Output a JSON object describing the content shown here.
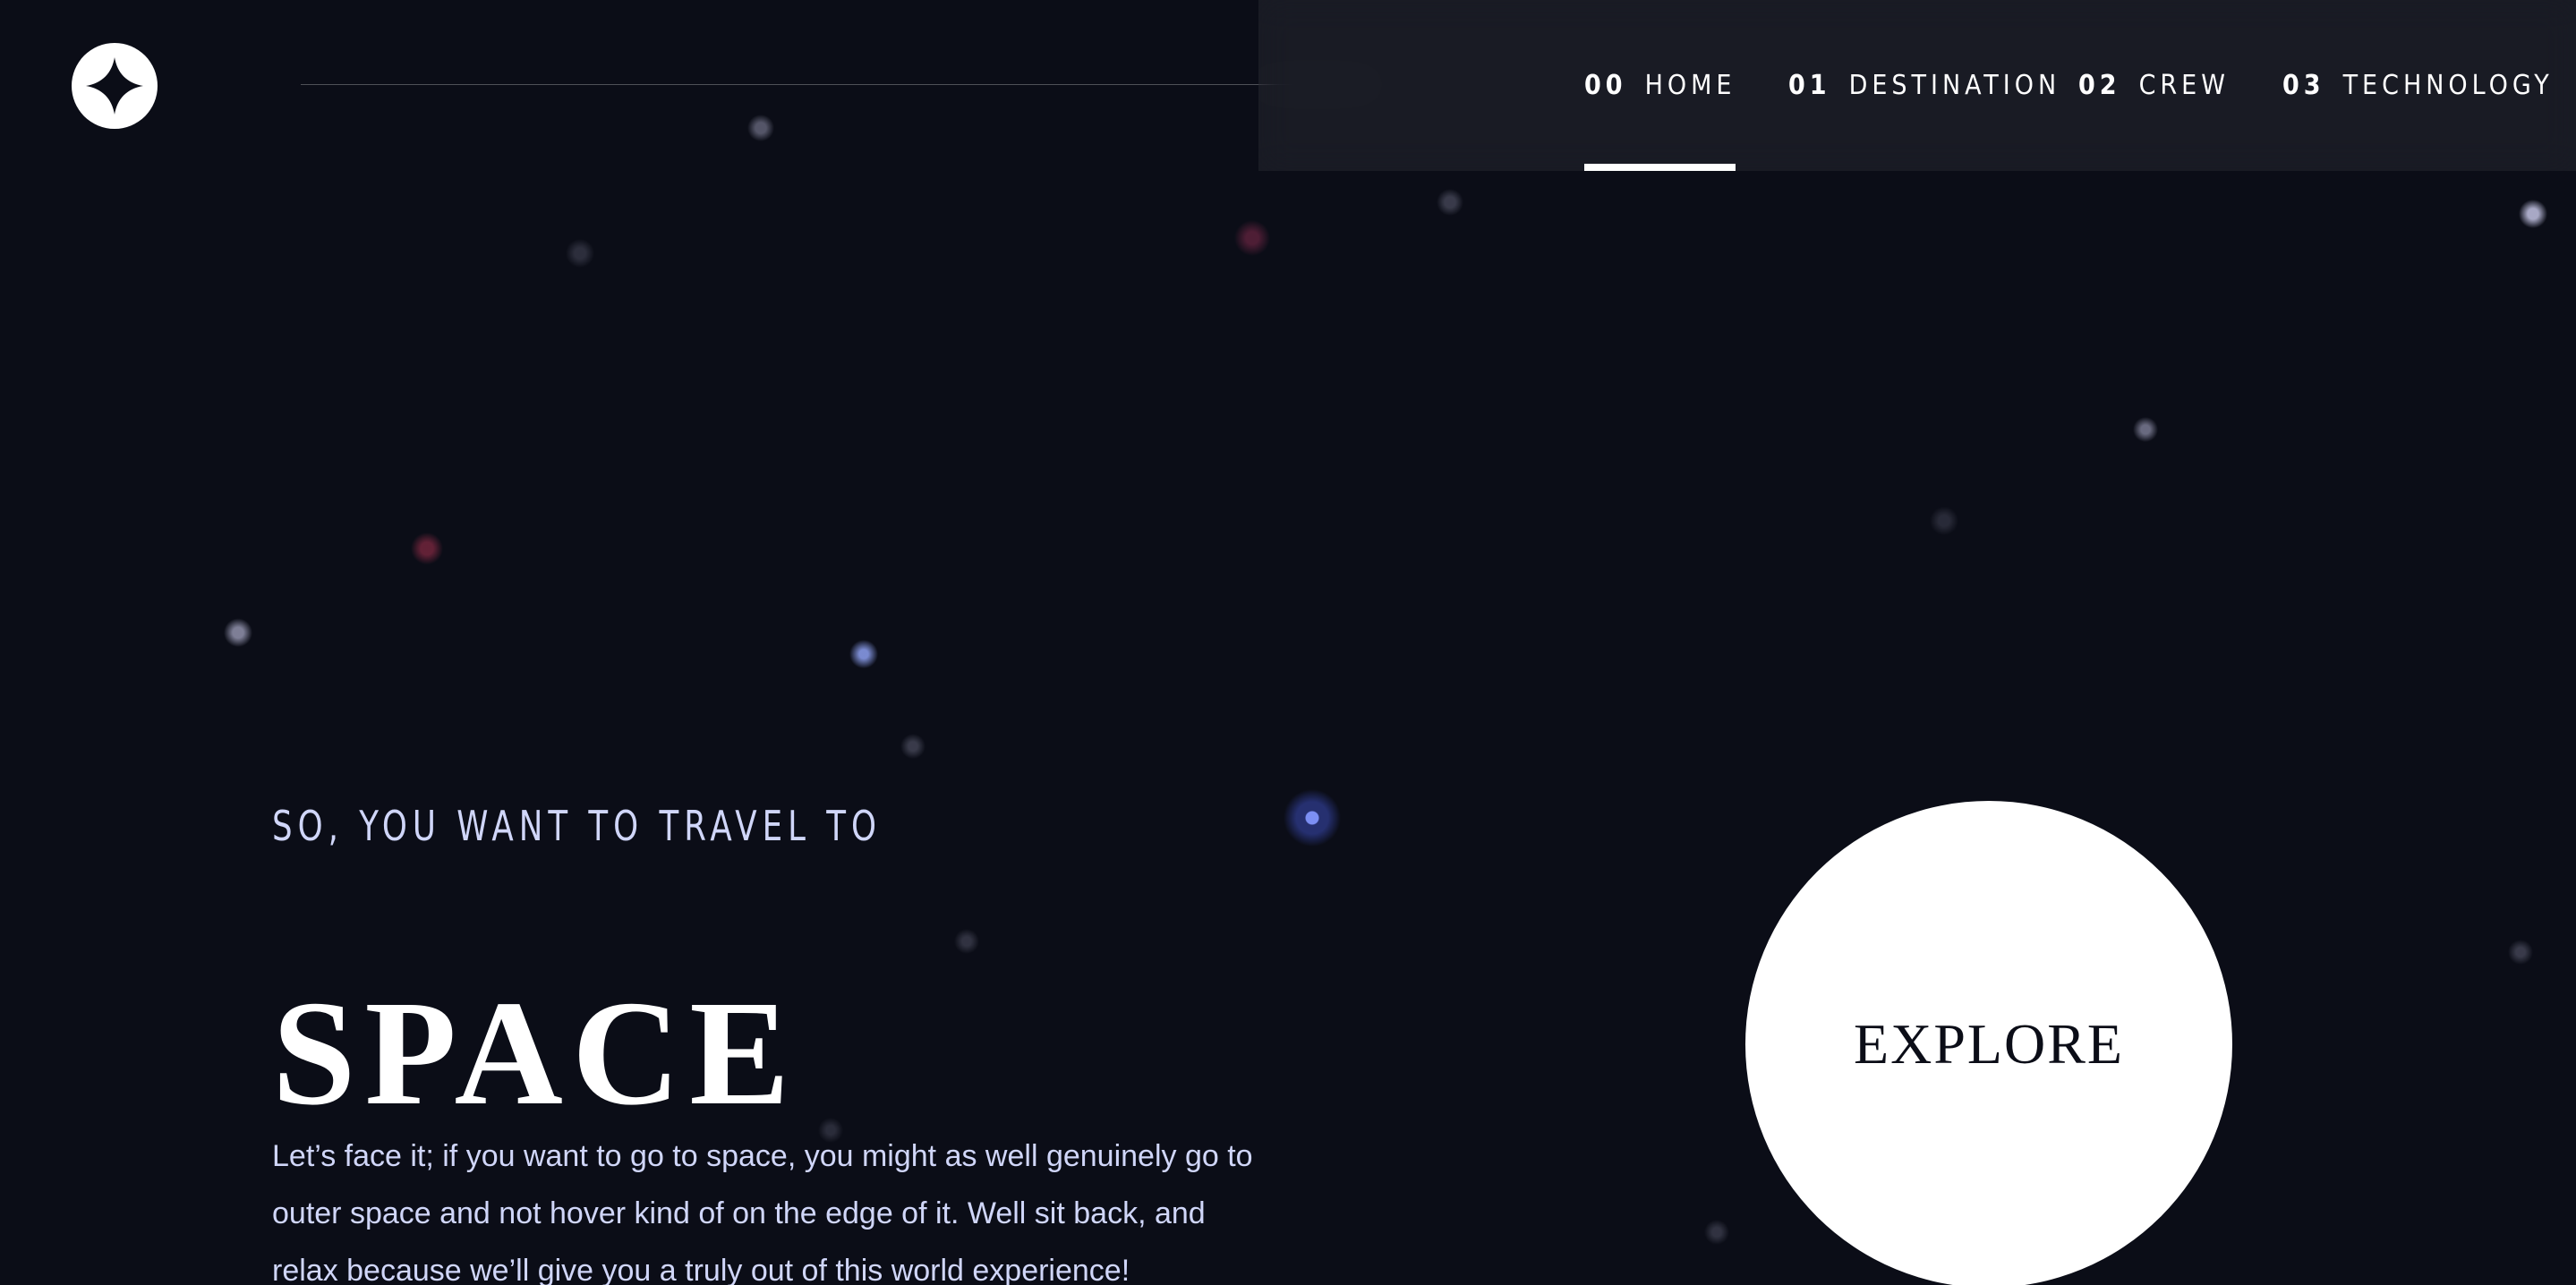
{
  "logo": {
    "icon": "four-point-star-icon"
  },
  "nav": {
    "items": [
      {
        "number": "00",
        "label": "HOME",
        "active": true
      },
      {
        "number": "01",
        "label": "DESTINATION",
        "active": false
      },
      {
        "number": "02",
        "label": "CREW",
        "active": false
      },
      {
        "number": "03",
        "label": "TECHNOLOGY",
        "active": false
      }
    ]
  },
  "hero": {
    "subtitle": "SO, YOU WANT TO TRAVEL TO",
    "title": "SPACE",
    "body": "Let’s face it; if you want to go to space, you might as well genuinely go to outer space and not hover kind of on the edge of it. Well sit back, and relax because we’ll give you a truly out of this world experience!",
    "button": "EXPLORE"
  },
  "colors": {
    "background": "#0b0d17",
    "text": "#ffffff",
    "secondary_text": "#d0d6f9",
    "button": "#ffffff",
    "button_text": "#0b0d17"
  }
}
